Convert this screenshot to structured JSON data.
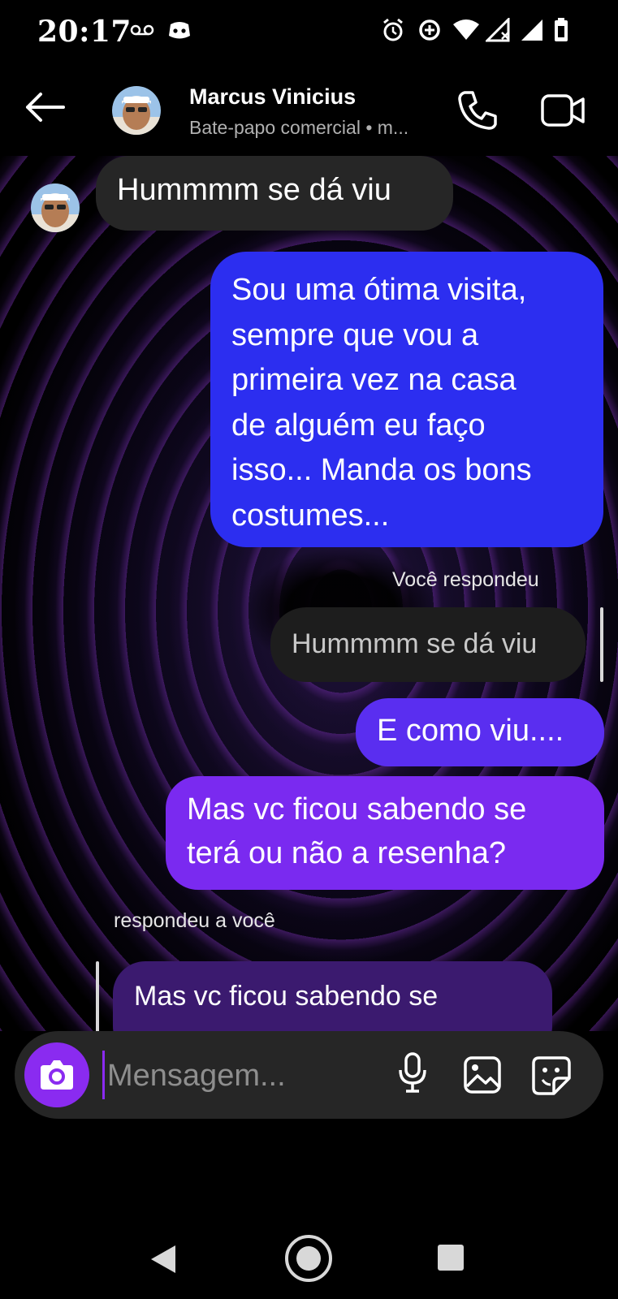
{
  "status_bar": {
    "time": "20:17"
  },
  "header": {
    "contact_name": "Marcus Vinicius",
    "subtitle": "Bate-papo comercial • m..."
  },
  "messages": {
    "m1": "Hummmm se dá viu",
    "m2_lines": [
      "Sou uma ótima visita,",
      "sempre que vou a",
      "primeira vez na casa",
      "de alguém eu faço",
      "isso... Manda os bons",
      "costumes..."
    ],
    "reply_label_out": "Você respondeu",
    "quoted_out": "Hummmm se dá viu",
    "m3": "E como viu....",
    "m4_lines": [
      "Mas vc ficou sabendo se",
      "terá ou não a resenha?"
    ],
    "reply_label_in": "respondeu a você",
    "quoted_in": "Mas vc ficou sabendo se"
  },
  "composer": {
    "placeholder": "Mensagem..."
  },
  "colors": {
    "incoming_bubble": "#262626",
    "outgoing_top": "#2c2ef0",
    "outgoing_bottom": "#8a2bf0",
    "accent": "#8a2bf0",
    "quoted_incoming": "#3b1a6f"
  },
  "icons": {
    "status_bar": [
      "voicemail-icon",
      "discord-icon",
      "alarm-icon",
      "data-saver-icon",
      "wifi-icon",
      "signal-icon",
      "signal-icon-2",
      "battery-icon"
    ],
    "header": [
      "back-arrow-icon",
      "phone-icon",
      "video-call-icon"
    ],
    "composer": [
      "camera-icon",
      "microphone-icon",
      "gallery-icon",
      "sticker-icon"
    ],
    "nav": [
      "nav-back-icon",
      "nav-home-icon",
      "nav-recents-icon"
    ]
  }
}
